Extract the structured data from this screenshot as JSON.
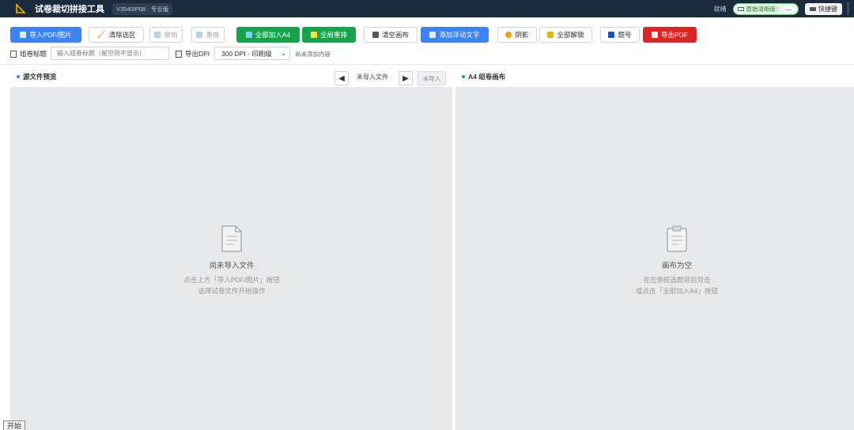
{
  "app": {
    "title": "试卷裁切拼接工具",
    "version": "V3540IP08 · 专业版",
    "status": "就绪",
    "clarity_label": "原始清晰度：",
    "clarity_value": "—",
    "shortcut_label": "快捷键"
  },
  "toolbar": {
    "import": "导入PDF/图片",
    "clear_selection": "清除选区",
    "undo": "撤销",
    "redo": "重做",
    "add_all_a4": "全部加入A4",
    "rearrange": "全局重排",
    "clear_canvas": "清空画布",
    "add_float_text": "添加浮动文字",
    "shadow": "阴影",
    "unlock_all": "全部解锁",
    "question_no": "题号",
    "export_pdf": "导出PDF"
  },
  "options": {
    "title_label": "组卷标题",
    "title_placeholder": "输入组卷标题（留空则不显示）",
    "dpi_label": "导出DPI",
    "dpi_value": "300 DPI · 印刷级",
    "hint": "尚未添加内容"
  },
  "left_panel": {
    "title": "源文件预览",
    "file_status": "未导入文件",
    "not_imported": "未导入",
    "empty_title": "尚未导入文件",
    "empty_line1": "点击上方「导入PDF/图片」按钮",
    "empty_line2": "选择试卷文件开始操作"
  },
  "right_panel": {
    "title": "A4 组卷画布",
    "empty_title": "画布为空",
    "empty_line1": "在左侧框选题目后双击",
    "empty_line2": "或点击「全部加入A4」按钮"
  },
  "taskbar": {
    "start": "开始"
  },
  "colors": {
    "titlebar": "#1c2a3d",
    "blue": "#3b82f6",
    "green": "#16a34a",
    "red": "#dc2626",
    "panel_bg": "#e8e9eb"
  }
}
